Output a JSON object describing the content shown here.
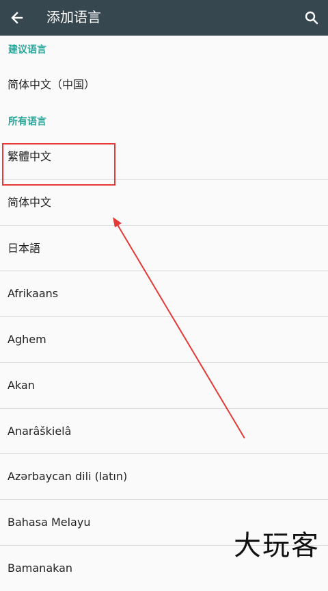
{
  "appbar": {
    "title": "添加语言",
    "back_icon": "arrow-back-icon",
    "search_icon": "search-icon"
  },
  "sections": {
    "suggested_header": "建议语言",
    "all_header": "所有语言"
  },
  "suggested": [
    {
      "label": "简体中文（中国）"
    }
  ],
  "languages": [
    {
      "label": "繁體中文"
    },
    {
      "label": "简体中文"
    },
    {
      "label": "日本語"
    },
    {
      "label": "Afrikaans"
    },
    {
      "label": "Aghem"
    },
    {
      "label": "Akan"
    },
    {
      "label": "Anarâškielâ"
    },
    {
      "label": "Azərbaycan dili (latın)"
    },
    {
      "label": "Bahasa Melayu"
    },
    {
      "label": "Bamanakan"
    }
  ],
  "annotation": {
    "highlight_color": "#e53935"
  },
  "watermark": "大玩客",
  "colors": {
    "appbar": "#37474f",
    "section_header": "#26a69a",
    "background": "#fafafa"
  }
}
